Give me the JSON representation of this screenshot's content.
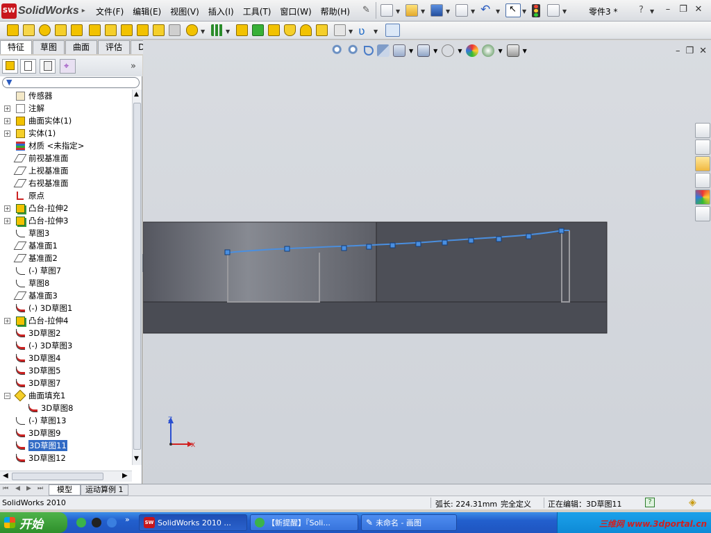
{
  "app": {
    "logo_badge": "SW",
    "logo_text": "SolidWorks",
    "doc_title": "零件3 *"
  },
  "menus": [
    "文件(F)",
    "编辑(E)",
    "视图(V)",
    "插入(I)",
    "工具(T)",
    "窗口(W)",
    "帮助(H)"
  ],
  "help_glyph": "?",
  "window_controls": [
    "–",
    "❐",
    "✕"
  ],
  "tabs": [
    "特征",
    "草图",
    "曲面",
    "评估",
    "DimXpert"
  ],
  "collapse_glyph": "»",
  "tree": [
    {
      "label": "传感器",
      "expand": false,
      "icon": "sensor-icon"
    },
    {
      "label": "注解",
      "expand": true,
      "icon": "annotation-icon"
    },
    {
      "label": "曲面实体(1)",
      "expand": true,
      "icon": "surface-body-icon"
    },
    {
      "label": "实体(1)",
      "expand": true,
      "icon": "solid-body-icon"
    },
    {
      "label": "材质 <未指定>",
      "expand": false,
      "icon": "material-icon"
    },
    {
      "label": "前视基准面",
      "expand": false,
      "icon": "plane-icon"
    },
    {
      "label": "上视基准面",
      "expand": false,
      "icon": "plane-icon"
    },
    {
      "label": "右视基准面",
      "expand": false,
      "icon": "plane-icon"
    },
    {
      "label": "原点",
      "expand": false,
      "icon": "origin-icon"
    },
    {
      "label": "凸台-拉伸2",
      "expand": true,
      "icon": "extrude-icon"
    },
    {
      "label": "凸台-拉伸3",
      "expand": true,
      "icon": "extrude-icon"
    },
    {
      "label": "草图3",
      "expand": false,
      "icon": "sketch-icon"
    },
    {
      "label": "基准面1",
      "expand": false,
      "icon": "plane-icon"
    },
    {
      "label": "基准面2",
      "expand": false,
      "icon": "plane-icon"
    },
    {
      "label": "(-) 草图7",
      "expand": false,
      "icon": "sketch-icon"
    },
    {
      "label": "草图8",
      "expand": false,
      "icon": "sketch-icon"
    },
    {
      "label": "基准面3",
      "expand": false,
      "icon": "plane-icon"
    },
    {
      "label": "(-) 3D草图1",
      "expand": false,
      "icon": "sketch3d-icon"
    },
    {
      "label": "凸台-拉伸4",
      "expand": true,
      "icon": "extrude-icon"
    },
    {
      "label": "3D草图2",
      "expand": false,
      "icon": "sketch3d-icon"
    },
    {
      "label": "(-) 3D草图3",
      "expand": false,
      "icon": "sketch3d-icon"
    },
    {
      "label": "3D草图4",
      "expand": false,
      "icon": "sketch3d-icon"
    },
    {
      "label": "3D草图5",
      "expand": false,
      "icon": "sketch3d-icon"
    },
    {
      "label": "3D草图7",
      "expand": false,
      "icon": "sketch3d-icon"
    },
    {
      "label": "曲面填充1",
      "expand": "open",
      "icon": "fill-surface-icon"
    },
    {
      "label": "3D草图8",
      "expand": false,
      "icon": "sketch3d-icon",
      "indent": true
    },
    {
      "label": "(-) 草图13",
      "expand": false,
      "icon": "sketch-icon"
    },
    {
      "label": "3D草图9",
      "expand": false,
      "icon": "sketch3d-icon"
    },
    {
      "label": "3D草图11",
      "expand": false,
      "icon": "sketch3d-icon",
      "selected": true
    },
    {
      "label": "3D草图12",
      "expand": false,
      "icon": "sketch3d-icon"
    }
  ],
  "triad": {
    "x": "X",
    "z": "Z"
  },
  "bottom_tabs": [
    "模型",
    "运动算例 1"
  ],
  "status": {
    "app": "SolidWorks 2010",
    "arc_length": "弧长: 224.31mm",
    "defined": "完全定义",
    "editing": "正在编辑：3D草图11",
    "help_glyph": "?"
  },
  "taskbar": {
    "start": "开始",
    "tasks": [
      "SolidWorks 2010 ...",
      "【新提醒】『Soli...",
      "未命名 - 画图"
    ],
    "watermark": "三维网 www.3dportal.cn"
  },
  "colors": {
    "accent_blue": "#316ac5",
    "sketch_curve": "#4a8fe0",
    "model_dark": "#4d4f57",
    "sw_red": "#c8161d"
  }
}
